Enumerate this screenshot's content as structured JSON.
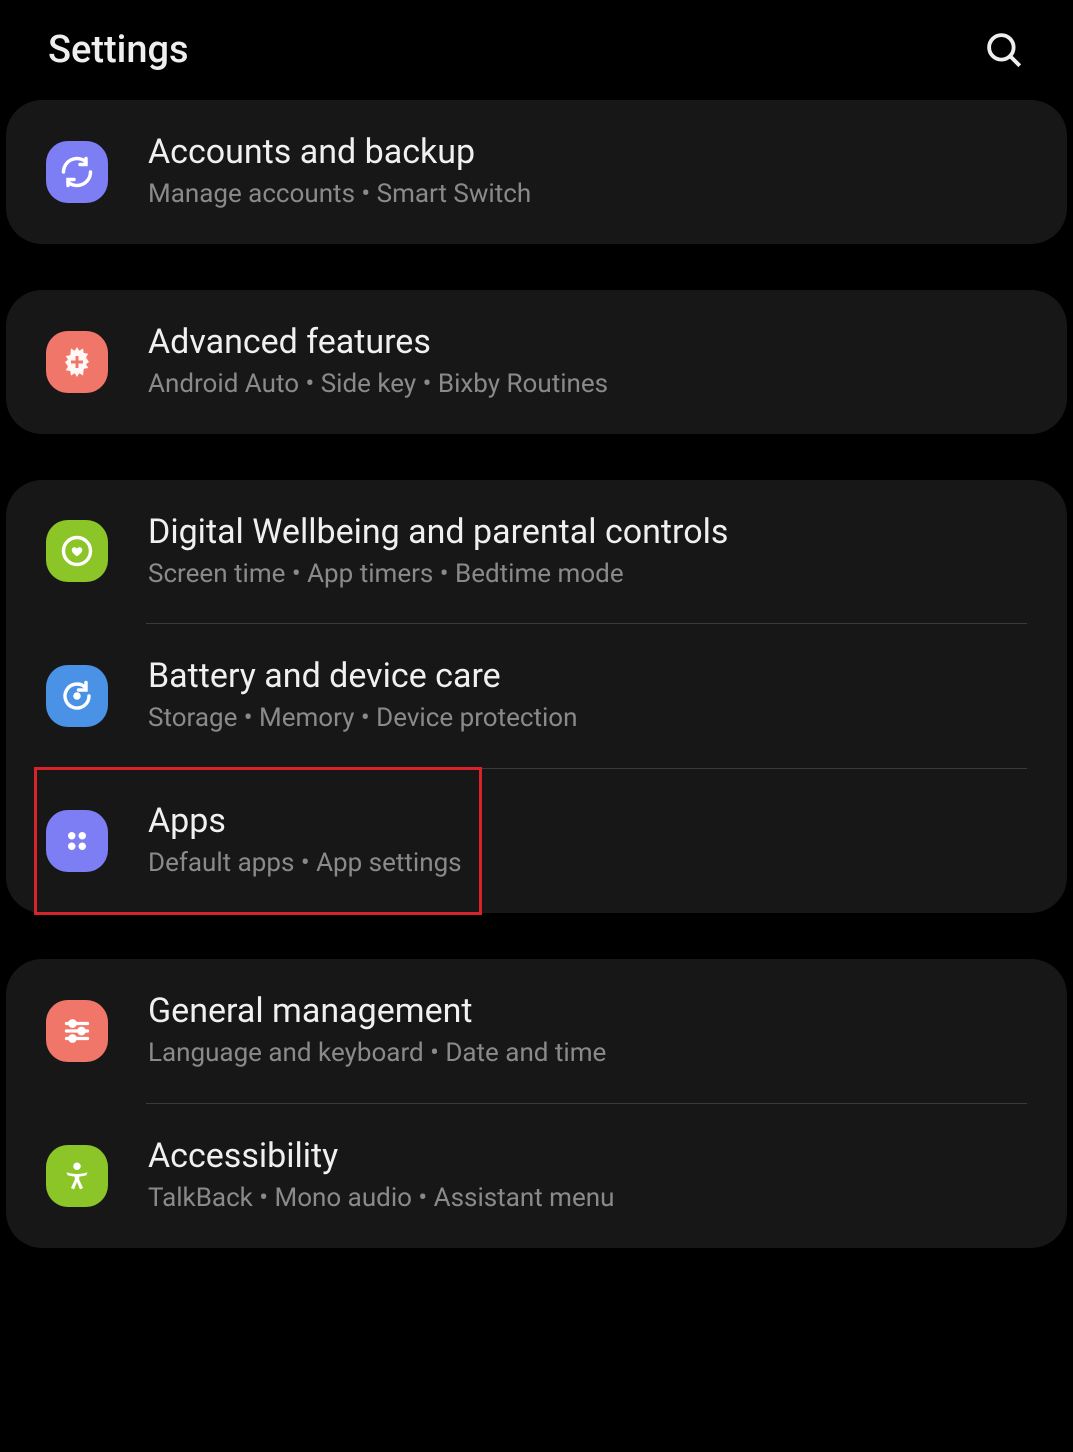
{
  "header": {
    "title": "Settings"
  },
  "groups": [
    {
      "items": [
        {
          "id": "accounts-and-backup",
          "title": "Accounts and backup",
          "subtitle": "Manage accounts  •  Smart Switch",
          "iconColor": "#7d7df4",
          "iconName": "sync-icon"
        }
      ]
    },
    {
      "items": [
        {
          "id": "advanced-features",
          "title": "Advanced features",
          "subtitle": "Android Auto  •  Side key  •  Bixby Routines",
          "iconColor": "#f1766a",
          "iconName": "plus-gear-icon"
        }
      ]
    },
    {
      "items": [
        {
          "id": "digital-wellbeing",
          "title": "Digital Wellbeing and parental controls",
          "subtitle": "Screen time  •  App timers  •  Bedtime mode",
          "iconColor": "#8bc528",
          "iconName": "heart-circle-icon"
        },
        {
          "id": "battery-device-care",
          "title": "Battery and device care",
          "subtitle": "Storage  •  Memory  •  Device protection",
          "iconColor": "#4992e6",
          "iconName": "refresh-icon"
        },
        {
          "id": "apps",
          "title": "Apps",
          "subtitle": "Default apps  •  App settings",
          "iconColor": "#7d7df4",
          "iconName": "apps-dots-icon",
          "highlighted": true
        }
      ]
    },
    {
      "items": [
        {
          "id": "general-management",
          "title": "General management",
          "subtitle": "Language and keyboard  •  Date and time",
          "iconColor": "#f1766a",
          "iconName": "sliders-icon"
        },
        {
          "id": "accessibility",
          "title": "Accessibility",
          "subtitle": "TalkBack  •  Mono audio  •  Assistant menu",
          "iconColor": "#8bc528",
          "iconName": "person-icon"
        }
      ]
    }
  ]
}
